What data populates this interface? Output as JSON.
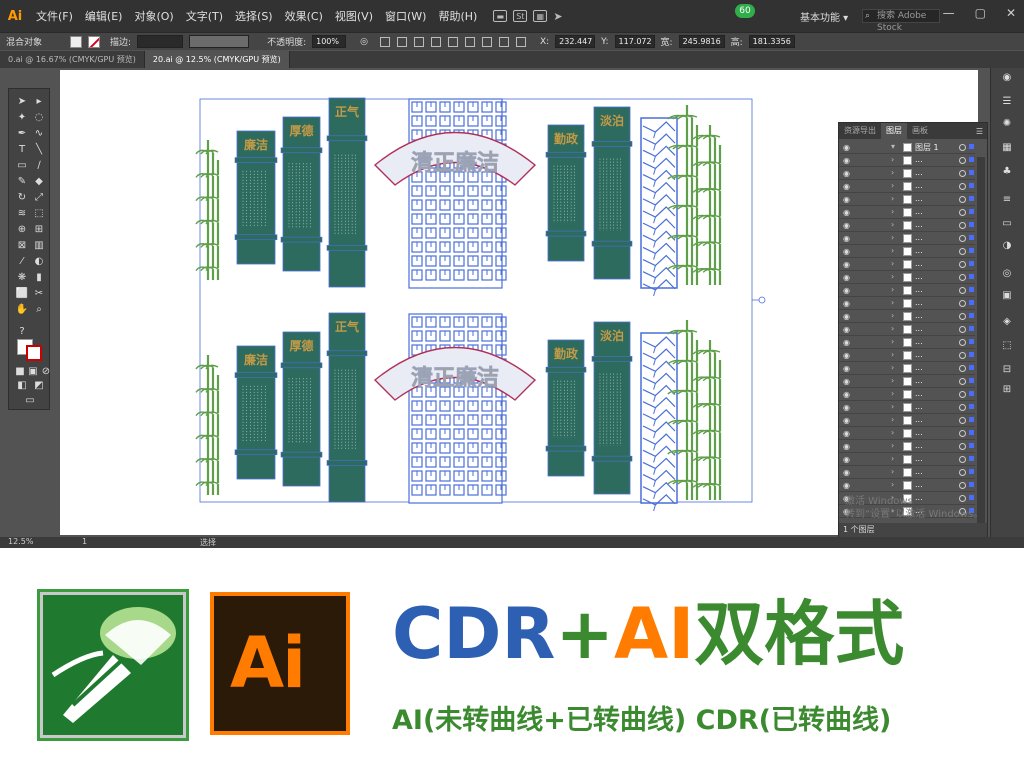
{
  "app": {
    "logo": "Ai"
  },
  "menu": [
    "文件(F)",
    "编辑(E)",
    "对象(O)",
    "文字(T)",
    "选择(S)",
    "效果(C)",
    "视图(V)",
    "窗口(W)",
    "帮助(H)"
  ],
  "menu_icons": [
    "st-icon",
    "layout-icon",
    "send-icon"
  ],
  "badge": "60",
  "workspace": "基本功能",
  "search_placeholder": "搜索 Adobe Stock",
  "control": {
    "object_type": "混合对象",
    "stroke_label": "描边:",
    "opacity_label": "不透明度:",
    "opacity_value": "100%",
    "x_label": "X:",
    "x_value": "232.447",
    "y_label": "Y:",
    "y_value": "117.072",
    "w_label": "宽:",
    "w_value": "245.9816",
    "h_label": "高:",
    "h_value": "181.3356"
  },
  "tabs": [
    {
      "label": "0.ai @ 16.67% (CMYK/GPU 预览)",
      "active": false
    },
    {
      "label": "20.ai @ 12.5% (CMYK/GPU 预览)",
      "active": true
    }
  ],
  "panel": {
    "tabs": [
      "资源导出",
      "图层",
      "画板"
    ],
    "active_tab": "图层",
    "top_layer": "图层 1",
    "footer": "1 个图层"
  },
  "canvas": {
    "top": {
      "panels": [
        "廉洁",
        "厚德",
        "正气",
        "勤政",
        "淡泊"
      ],
      "arch_title": "清正廉洁"
    },
    "bottom": {
      "panels": [
        "廉洁",
        "厚德",
        "正气",
        "勤政",
        "淡泊"
      ],
      "arch_title": "清正廉洁"
    },
    "colors": {
      "panel_fill": "#2e6b5f",
      "panel_outline": "#4a6fd8",
      "bamboo": "#5f9f4a",
      "lattice": "#4a6fd8",
      "title_gold": "#c59a45"
    }
  },
  "windows_watermark": [
    "激活 Windows",
    "转到“设置”以激活 Windows。"
  ],
  "status": {
    "zoom": "12.5%",
    "page": "1",
    "mode": "选择"
  },
  "banner": {
    "cdr_logo_colors": {
      "bg": "#1f7a2f",
      "border": "#3a9b3f"
    },
    "ai_logo_text": "Ai",
    "headline": {
      "part1": "CDR",
      "plus": "+",
      "part2": "AI",
      "part3": "双格式"
    },
    "subline": "AI(未转曲线+已转曲线) CDR(已转曲线)"
  }
}
